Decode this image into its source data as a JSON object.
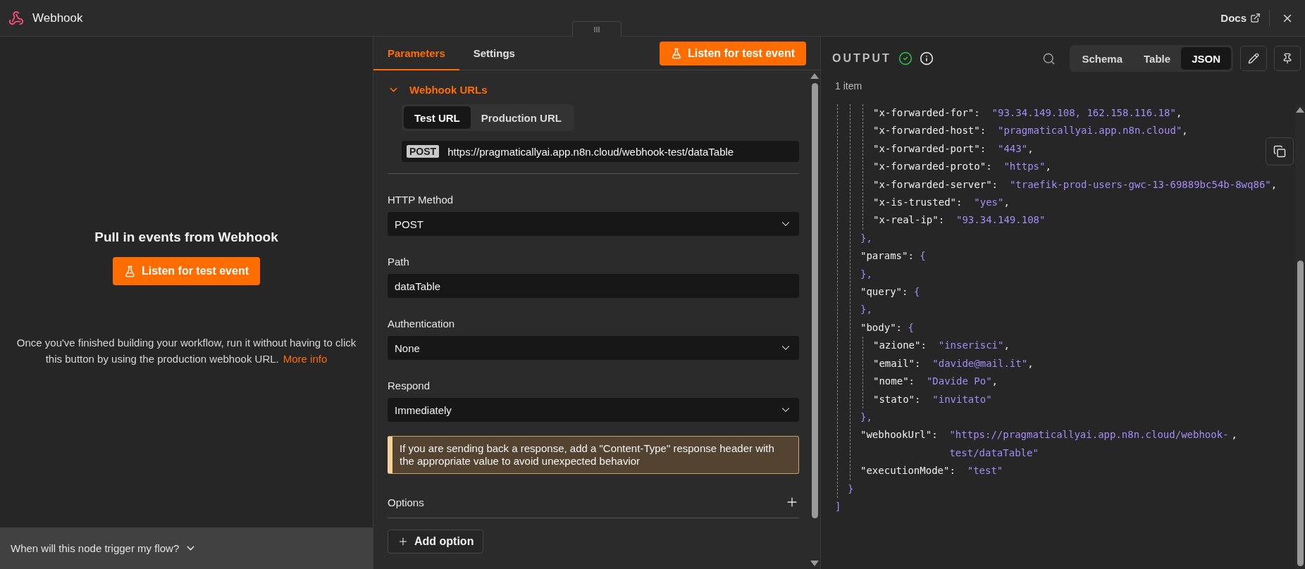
{
  "header": {
    "title": "Webhook",
    "docs": "Docs"
  },
  "left": {
    "heading": "Pull in events from Webhook",
    "listen_button": "Listen for test event",
    "description": "Once you've finished building your workflow, run it without having to click this button by using the production webhook URL.",
    "more_info": "More info",
    "footer": "When will this node trigger my flow?"
  },
  "middle": {
    "tabs": [
      {
        "label": "Parameters",
        "selected": true
      },
      {
        "label": "Settings",
        "selected": false
      }
    ],
    "listen_button": "Listen for test event",
    "webhook_urls": {
      "title": "Webhook URLs",
      "expanded": true,
      "url_tabs": [
        {
          "label": "Test URL",
          "selected": true
        },
        {
          "label": "Production URL",
          "selected": false
        }
      ],
      "method_badge": "POST",
      "url": "https://pragmaticallyai.app.n8n.cloud/webhook-test/dataTable"
    },
    "fields": [
      {
        "label": "HTTP Method",
        "kind": "select",
        "value": "POST"
      },
      {
        "label": "Path",
        "kind": "text",
        "value": "dataTable"
      },
      {
        "label": "Authentication",
        "kind": "select",
        "value": "None"
      },
      {
        "label": "Respond",
        "kind": "select",
        "value": "Immediately"
      }
    ],
    "notice": "If you are sending back a response, add a \"Content-Type\" response header with the appropriate value to avoid unexpected behavior",
    "options": {
      "label": "Options",
      "add_button": "Add option"
    }
  },
  "output": {
    "title": "OUTPUT",
    "view_tabs": [
      {
        "label": "Schema",
        "selected": false
      },
      {
        "label": "Table",
        "selected": false
      },
      {
        "label": "JSON",
        "selected": true
      }
    ],
    "item_count": "1 item",
    "json_tree": {
      "close": "]",
      "children": [
        {
          "close": "}",
          "children": [
            {
              "close": "},",
              "children": [
                {
                  "key": "\"x-forwarded-for\":",
                  "value": "\"93.34.149.108, 162.158.116.18\"",
                  "trail": ","
                },
                {
                  "key": "\"x-forwarded-host\":",
                  "value": "\"pragmaticallyai.app.n8n.cloud\"",
                  "trail": ","
                },
                {
                  "key": "\"x-forwarded-port\":",
                  "value": "\"443\"",
                  "trail": ","
                },
                {
                  "key": "\"x-forwarded-proto\":",
                  "value": "\"https\"",
                  "trail": ","
                },
                {
                  "key": "\"x-forwarded-server\":",
                  "value": "\"traefik-prod-users-gwc-13-69889bc54b-8wq86\"",
                  "trail": ","
                },
                {
                  "key": "\"x-is-trusted\":",
                  "value": "\"yes\"",
                  "trail": ","
                },
                {
                  "key": "\"x-real-ip\":",
                  "value": "\"93.34.149.108\""
                }
              ]
            },
            {
              "key": "\"params\":",
              "open": "{",
              "close": "},"
            },
            {
              "key": "\"query\":",
              "open": "{",
              "close": "},"
            },
            {
              "key": "\"body\":",
              "open": "{",
              "close": "},",
              "children": [
                {
                  "key": "\"azione\":",
                  "value": "\"inserisci\"",
                  "trail": ","
                },
                {
                  "key": "\"email\":",
                  "value": "\"davide@mail.it\"",
                  "trail": ","
                },
                {
                  "key": "\"nome\":",
                  "value": "\"Davide Po\"",
                  "trail": ","
                },
                {
                  "key": "\"stato\":",
                  "value": "\"invitato\""
                }
              ]
            },
            {
              "key": "\"webhookUrl\":",
              "value": "\"https://pragmaticallyai.app.n8n.cloud/webhook-test/dataTable\"",
              "trail": ","
            },
            {
              "key": "\"executionMode\":",
              "value": "\"test\""
            }
          ]
        }
      ]
    }
  }
}
